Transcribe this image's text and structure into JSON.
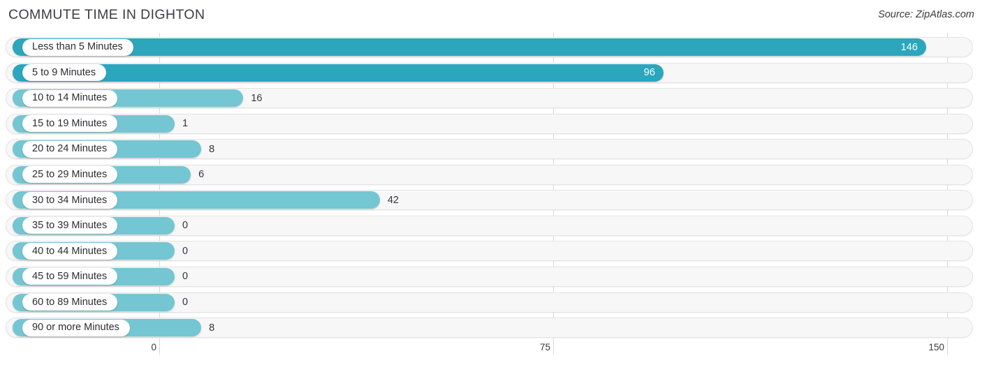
{
  "header": {
    "title": "COMMUTE TIME IN DIGHTON",
    "source": "Source: ZipAtlas.com"
  },
  "colors": {
    "bar_strong": "#2ba6bd",
    "bar_light": "#74c6d3",
    "track": "#f7f7f7",
    "gridline": "#d8d8d8",
    "text": "#34343c"
  },
  "chart_data": {
    "type": "bar",
    "orientation": "horizontal",
    "title": "COMMUTE TIME IN DIGHTON",
    "xlabel": "",
    "ylabel": "",
    "xlim": [
      0,
      150
    ],
    "ticks": [
      "0",
      "75",
      "150"
    ],
    "tick_values": [
      0,
      75,
      150
    ],
    "grid": true,
    "legend": "none",
    "categories": [
      "Less than 5 Minutes",
      "5 to 9 Minutes",
      "10 to 14 Minutes",
      "15 to 19 Minutes",
      "20 to 24 Minutes",
      "25 to 29 Minutes",
      "30 to 34 Minutes",
      "35 to 39 Minutes",
      "40 to 44 Minutes",
      "45 to 59 Minutes",
      "60 to 89 Minutes",
      "90 or more Minutes"
    ],
    "values": [
      146,
      96,
      16,
      1,
      8,
      6,
      42,
      0,
      0,
      0,
      0,
      8
    ],
    "value_labels": [
      "146",
      "96",
      "16",
      "1",
      "8",
      "6",
      "42",
      "0",
      "0",
      "0",
      "0",
      "8"
    ]
  }
}
